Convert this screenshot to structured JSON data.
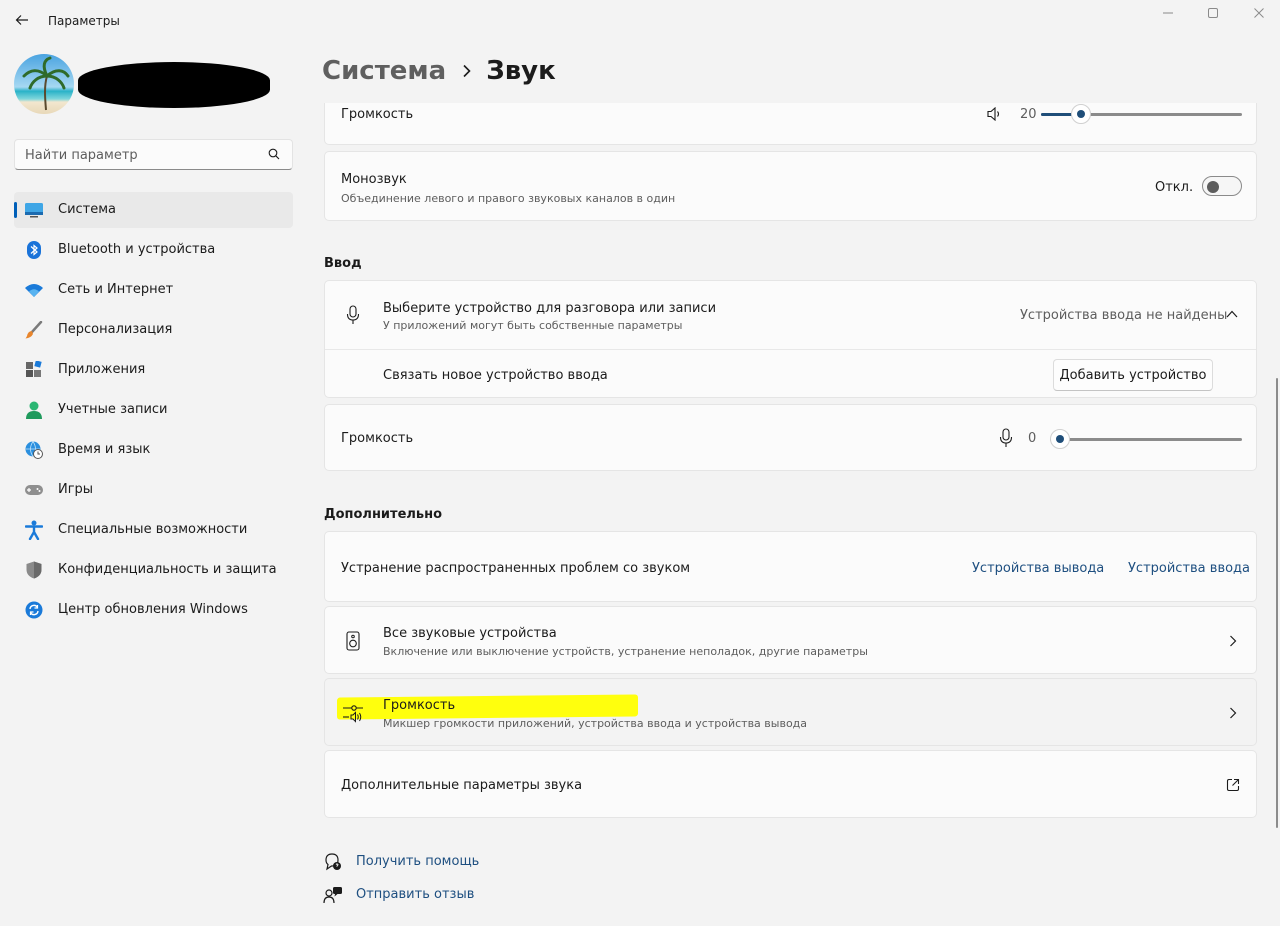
{
  "window": {
    "title": "Параметры"
  },
  "sidebar": {
    "search_placeholder": "Найти параметр",
    "items": [
      {
        "label": "Система",
        "icon": "system-icon",
        "active": true
      },
      {
        "label": "Bluetooth и устройства",
        "icon": "bluetooth-icon"
      },
      {
        "label": "Сеть и Интернет",
        "icon": "wifi-icon"
      },
      {
        "label": "Персонализация",
        "icon": "brush-icon"
      },
      {
        "label": "Приложения",
        "icon": "apps-icon"
      },
      {
        "label": "Учетные записи",
        "icon": "account-icon"
      },
      {
        "label": "Время и язык",
        "icon": "globe-clock-icon"
      },
      {
        "label": "Игры",
        "icon": "gamepad-icon"
      },
      {
        "label": "Специальные возможности",
        "icon": "accessibility-icon"
      },
      {
        "label": "Конфиденциальность и защита",
        "icon": "shield-icon"
      },
      {
        "label": "Центр обновления Windows",
        "icon": "update-icon"
      }
    ]
  },
  "breadcrumb": {
    "parent": "Система",
    "current": "Звук"
  },
  "output": {
    "volume_label": "Громкость",
    "volume_value": "20",
    "volume_fraction": 0.2,
    "mono_title": "Монозвук",
    "mono_sub": "Объединение левого и правого звуковых каналов в один",
    "mono_state": "Откл."
  },
  "input": {
    "section_title": "Ввод",
    "choose_title": "Выберите устройство для разговора или записи",
    "choose_sub": "У приложений могут быть собственные параметры",
    "choose_status": "Устройства ввода не найдены",
    "pair_label": "Связать новое устройство ввода",
    "add_button": "Добавить устройство",
    "volume_label": "Громкость",
    "volume_value": "0",
    "volume_fraction": 0
  },
  "advanced": {
    "section_title": "Дополнительно",
    "troubleshoot_label": "Устранение распространенных проблем со звуком",
    "troubleshoot_output": "Устройства вывода",
    "troubleshoot_input": "Устройства ввода",
    "all_devices_title": "Все звуковые устройства",
    "all_devices_sub": "Включение или выключение устройств, устранение неполадок, другие параметры",
    "mixer_title": "Громкость",
    "mixer_sub": "Микшер громкости приложений, устройства ввода и устройства вывода",
    "more_label": "Дополнительные параметры звука"
  },
  "footer": {
    "help": "Получить помощь",
    "feedback": "Отправить отзыв"
  },
  "colors": {
    "accent": "#005fb8",
    "slider_fill": "#1f4e79",
    "link": "#1e4f80",
    "highlight": "#ffff00"
  }
}
